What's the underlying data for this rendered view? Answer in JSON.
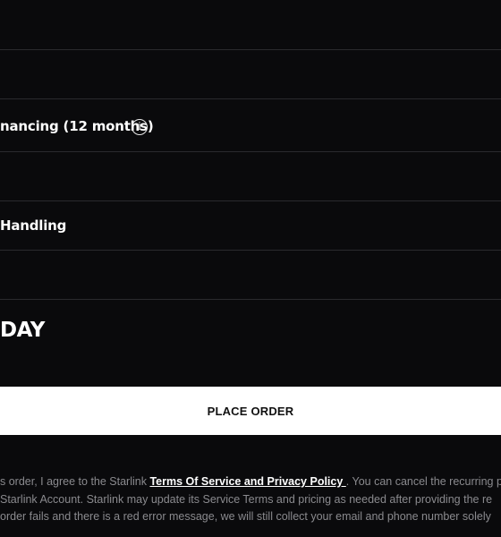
{
  "summary": {
    "financing_label": "nancing (12 months)",
    "info_icon": "info-icon",
    "handling_label": "Handling",
    "total_label": "DAY"
  },
  "order": {
    "place_order_label": "PLACE ORDER"
  },
  "legal": {
    "line1_prefix": "s order, I agree to the Starlink ",
    "terms_link": "Terms Of Service and Privacy Policy ",
    "line1_suffix": ". You can cancel the recurring pa",
    "line2": "Starlink Account. Starlink may update its Service Terms and pricing as needed after providing the re",
    "line3": "order fails and there is a red error message, we will still collect your email and phone number solely"
  },
  "colors": {
    "background": "#0a0a0c",
    "divider": "#2a2a2e",
    "button_bg": "#ffffff",
    "button_text": "#111111",
    "legal_text": "#8a8a8e"
  }
}
